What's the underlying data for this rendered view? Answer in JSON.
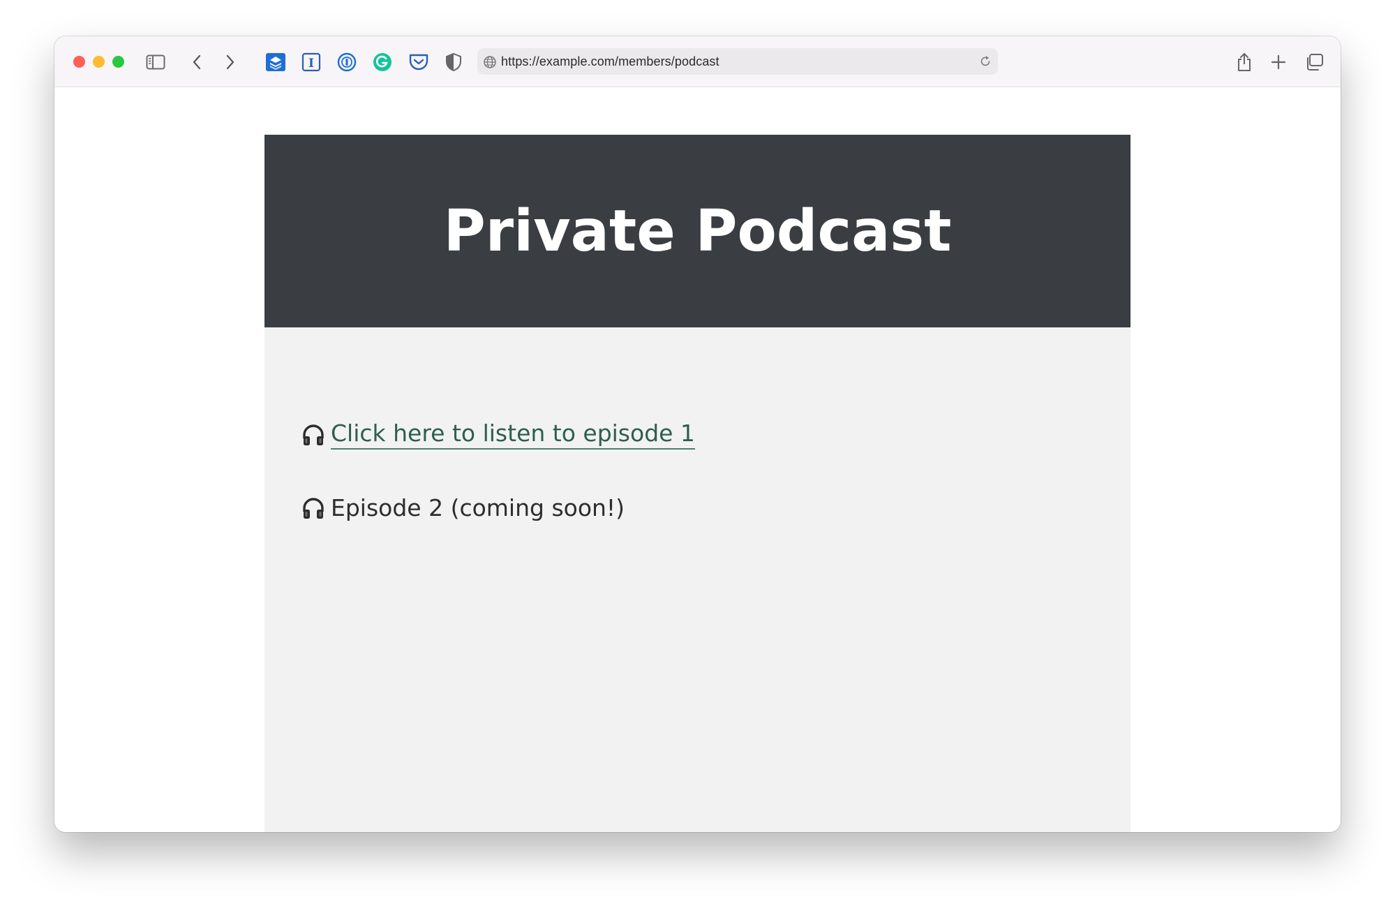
{
  "browser": {
    "url": "https://example.com/members/podcast",
    "extensions": [
      "buffer-icon",
      "instapaper-icon",
      "onepassword-icon",
      "grammarly-icon",
      "pocket-icon",
      "privacy-shield-icon"
    ]
  },
  "page": {
    "title": "Private Podcast",
    "episodes": [
      {
        "label": "Click here to listen to episode 1",
        "linked": true,
        "icon": "headphones-icon"
      },
      {
        "label": "Episode 2 (coming soon!)",
        "linked": false,
        "icon": "headphones-icon"
      }
    ]
  },
  "colors": {
    "hero_bg": "#3a3e43",
    "page_bg": "#f2f2f3",
    "link": "#2e5e4e"
  }
}
